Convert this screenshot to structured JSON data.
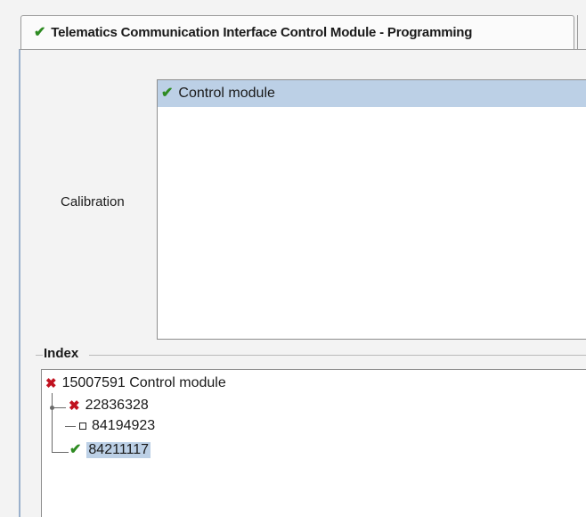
{
  "tab": {
    "title": "Telematics Communication Interface Control Module - Programming",
    "icon": "check-icon"
  },
  "calibration": {
    "label": "Calibration",
    "items": [
      {
        "label": "Control module",
        "icon": "check-icon",
        "selected": true
      }
    ]
  },
  "index": {
    "title": "Index",
    "tree": [
      {
        "text": "15007591 Control module",
        "icon": "x-icon",
        "level": 0
      },
      {
        "text": "22836328",
        "icon": "x-icon",
        "level": 1
      },
      {
        "text": "84194923",
        "icon": "square-icon",
        "level": 2
      },
      {
        "text": "84211117",
        "icon": "check-icon",
        "level": 1,
        "selected": true
      }
    ]
  },
  "colors": {
    "check": "#2e8b22",
    "error": "#c1121f",
    "selection": "#bcd0e6",
    "frame_accent": "#9ab0cc"
  }
}
